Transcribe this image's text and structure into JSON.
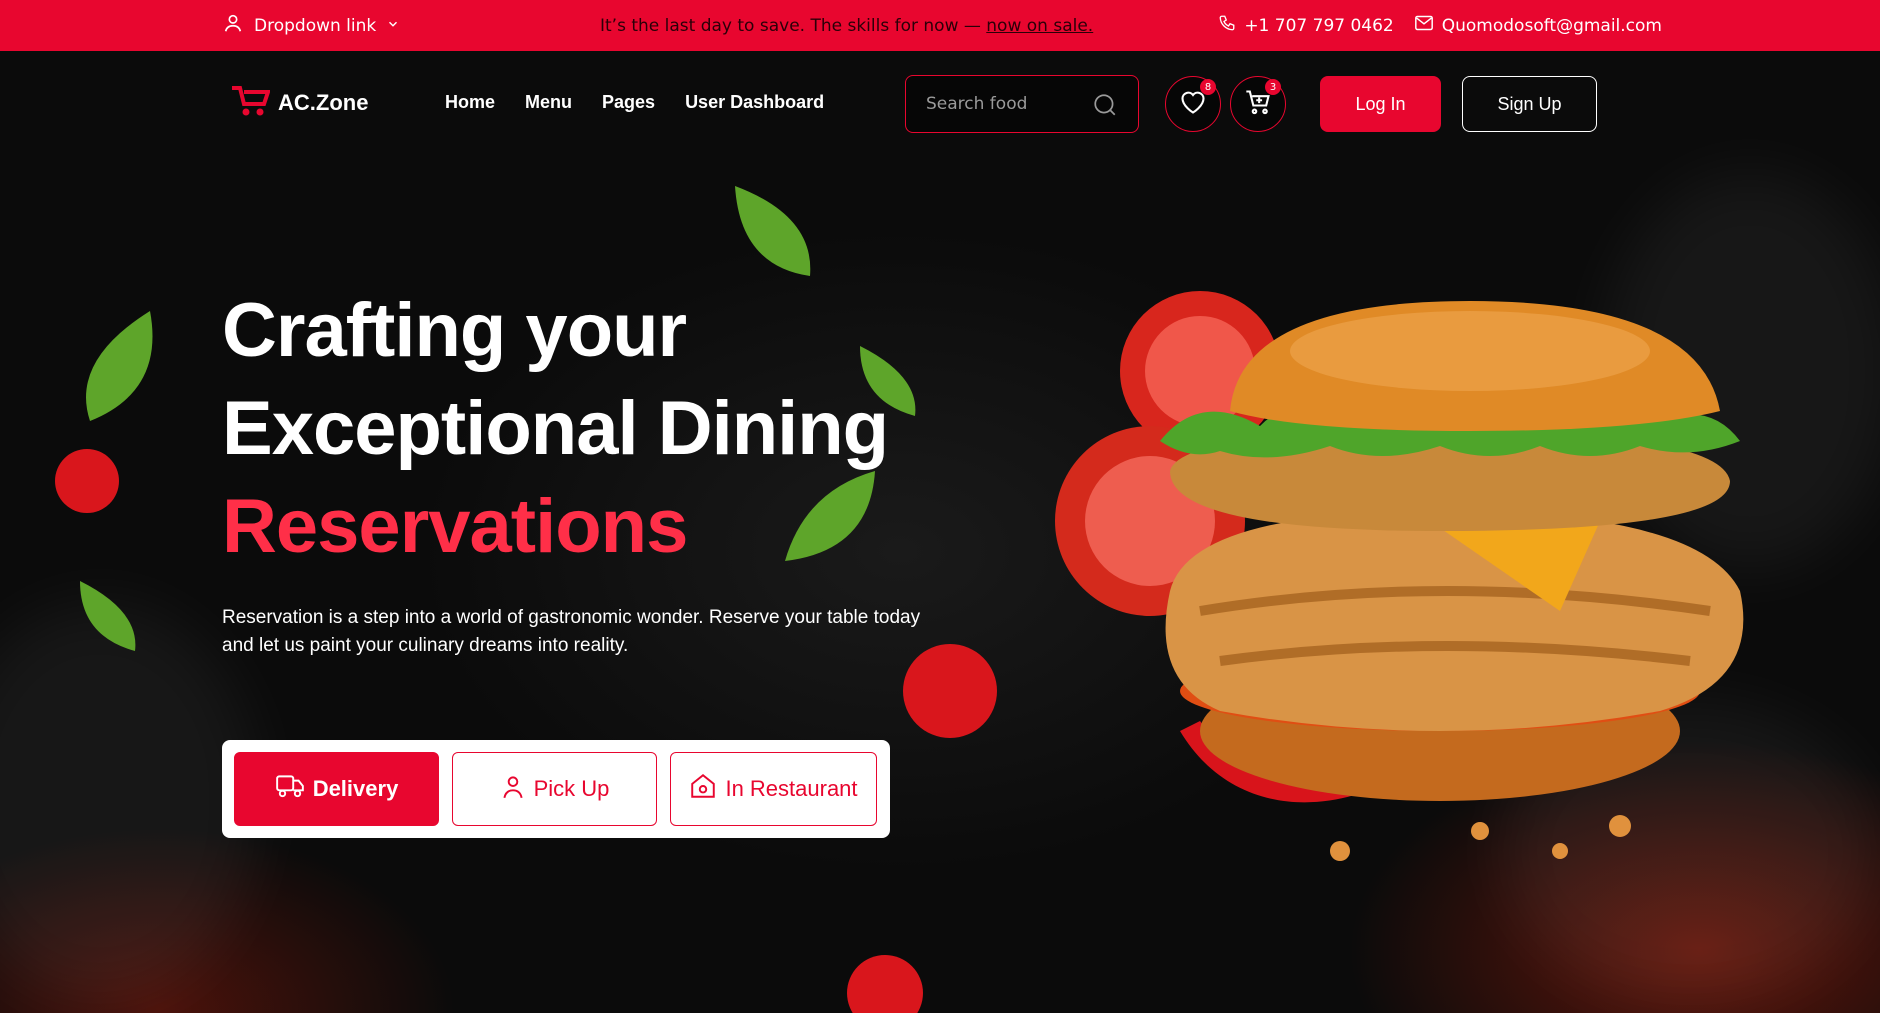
{
  "topbar": {
    "dropdown_label": "Dropdown link",
    "promo_text": "It’s the last day to save. The skills for now —",
    "promo_link": "now on sale.",
    "phone": "+1 707 797 0462",
    "email": "Quomodosoft@gmail.com"
  },
  "header": {
    "logo_text": "AC.Zone",
    "nav": [
      "Home",
      "Menu",
      "Pages",
      "User Dashboard"
    ],
    "search_placeholder": "Search food",
    "wishlist_count": "8",
    "cart_count": "3",
    "login_label": "Log In",
    "signup_label": "Sign Up"
  },
  "hero": {
    "line1": "Crafting your",
    "line2": "Exceptional Dining",
    "accent": "Reservations",
    "description": "Reservation is a step into a world of gastronomic wonder. Reserve your table today and let us paint your culinary dreams into reality.",
    "options": [
      "Delivery",
      "Pick Up",
      "In Restaurant"
    ]
  },
  "colors": {
    "brand": "#e8062f",
    "accent_text": "#ff2f48",
    "background": "#0d0d0d"
  }
}
